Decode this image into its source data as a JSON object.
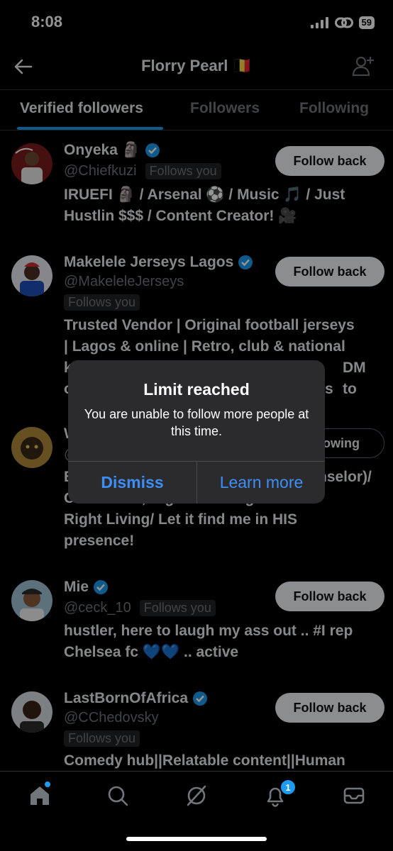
{
  "status_bar": {
    "time": "8:08",
    "battery": "59"
  },
  "header": {
    "title": "Florry Pearl 🇧🇪"
  },
  "tabs": [
    {
      "label": "Verified followers"
    },
    {
      "label": "Followers"
    },
    {
      "label": "Following"
    }
  ],
  "users": [
    {
      "name": "Onyeka 🗿",
      "handle": "@Chiefkuzi",
      "follows_you": "Follows you",
      "button": "Follow back",
      "bio": "IRUEFI 🗿 / Arsenal ⚽️ / Music 🎵 / Just Hustlin $$$ / Content Creator! 🎥"
    },
    {
      "name": "Makelele Jerseys Lagos",
      "handle": "@MakeleleJerseys",
      "follows_you": "Follows you",
      "button": "Follow back",
      "bio_line1": "Trusted Vendor | Original football jerseys",
      "bio_line2": "| Lagos & online | Retro, club & national",
      "bio_line3_start": "ki",
      "bio_line3_end": "DM to",
      "bio_line4_start": "o",
      "bio_line4_end": "s"
    },
    {
      "name_start": "W",
      "handle_start": "@",
      "button": "owing",
      "bio_line1_start": "B",
      "bio_line1_end": "nselor)/",
      "bio_line2": "Consultant, Right Thinking leads to",
      "bio_line3": "Right Living/ Let it find me in HIS",
      "bio_line4": "presence!"
    },
    {
      "name": "Mie",
      "handle": "@ceck_10",
      "follows_you": "Follows you",
      "button": "Follow back",
      "bio_line1": "hustler, here to laugh my ass out .. #I rep",
      "bio_line2": "Chelsea fc 💙💙 .. active"
    },
    {
      "name": "LastBornOfAfrica",
      "handle": "@CChedovsky",
      "follows_you": "Follows you",
      "button": "Follow back",
      "bio_line1": "Comedy hub||Relatable content||Human"
    }
  ],
  "alert": {
    "title": "Limit reached",
    "message": "You are unable to follow more people at this time.",
    "dismiss": "Dismiss",
    "learn_more": "Learn more"
  },
  "bottom_nav": {
    "notification_count": "1",
    "icons": [
      "home-icon",
      "search-icon",
      "grok-icon",
      "bell-icon",
      "mail-icon"
    ]
  },
  "colors": {
    "accent": "#1d9bf0",
    "alert_link": "#3e8ef7",
    "background": "#000000",
    "muted": "#71767b"
  }
}
